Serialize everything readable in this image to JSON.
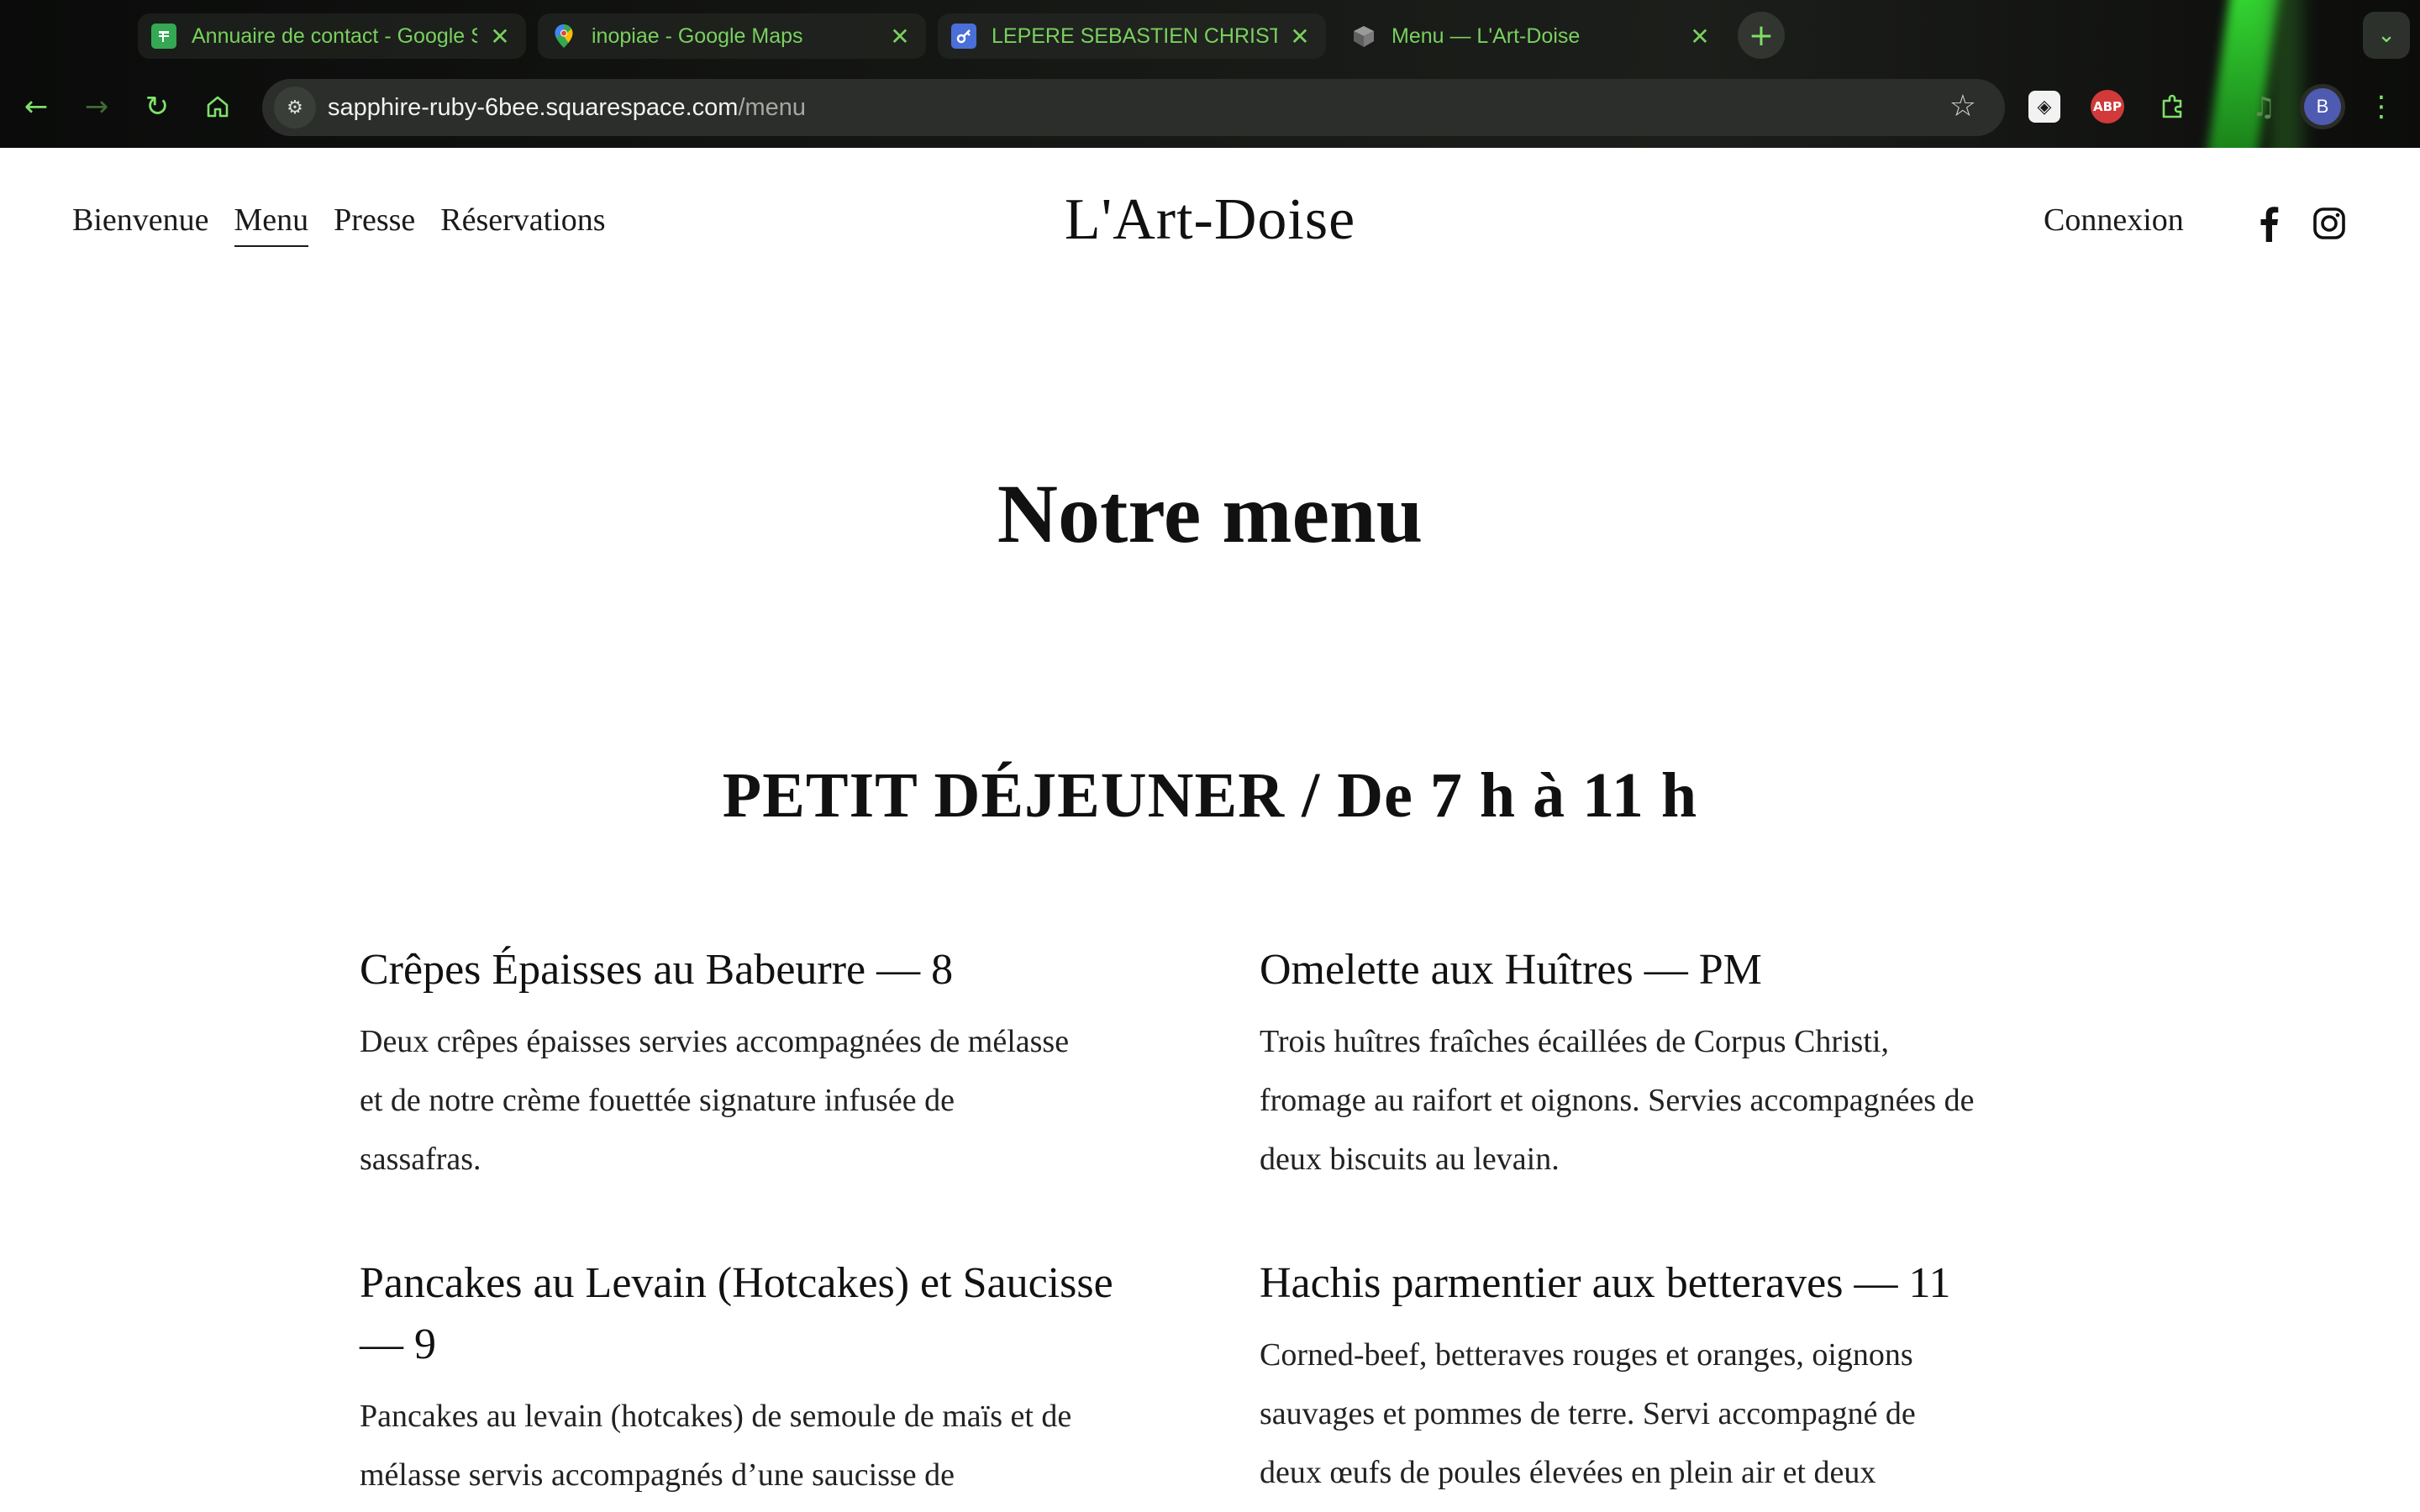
{
  "browser": {
    "tabs": [
      {
        "title": "Annuaire de contact - Google Sheets",
        "icon": "sheets-icon",
        "active": false
      },
      {
        "title": "inopiae - Google Maps",
        "icon": "maps-pin-icon",
        "active": false
      },
      {
        "title": "LEPERE SEBASTIEN CHRISTIAN",
        "icon": "key-icon",
        "active": false
      },
      {
        "title": "Menu — L'Art-Doise",
        "icon": "cube-icon",
        "active": true
      }
    ],
    "new_tab": "+",
    "url": {
      "host": "sapphire-ruby-6bee.squarespace.com",
      "path": "/menu"
    },
    "profile_initial": "B",
    "extensions": {
      "abp_label": "ABP"
    },
    "accent_color": "#79d05f"
  },
  "site": {
    "nav": [
      {
        "label": "Bienvenue",
        "current": false
      },
      {
        "label": "Menu",
        "current": true
      },
      {
        "label": "Presse",
        "current": false
      },
      {
        "label": "Réservations",
        "current": false
      }
    ],
    "logo": "L'Art-Doise",
    "login": "Connexion",
    "social": [
      "facebook-icon",
      "instagram-icon"
    ]
  },
  "menu": {
    "title": "Notre menu",
    "section": "PETIT DÉJEUNER / De 7 h à 11 h",
    "items": [
      {
        "name": "Crêpes Épaisses au Babeurre — 8",
        "description": "Deux crêpes épaisses servies accompagnées de mélasse et de notre crème fouettée signature infusée de sassafras."
      },
      {
        "name": "Omelette aux Huîtres — PM",
        "description": "Trois huîtres fraîches écaillées de Corpus Christi, fromage au raifort et oignons. Servies accompagnées de deux biscuits au levain."
      },
      {
        "name": "Pancakes au Levain (Hotcakes) et Saucisse — 9",
        "description": "Pancakes au levain (hotcakes) de semoule de maïs et de mélasse servis accompagnés d’une saucisse de"
      },
      {
        "name": "Hachis parmentier aux betteraves — 11",
        "description": "Corned-beef, betteraves rouges et oranges, oignons sauvages et pommes de terre. Servi accompagné de deux œufs de poules élevées en plein air et deux"
      }
    ]
  }
}
